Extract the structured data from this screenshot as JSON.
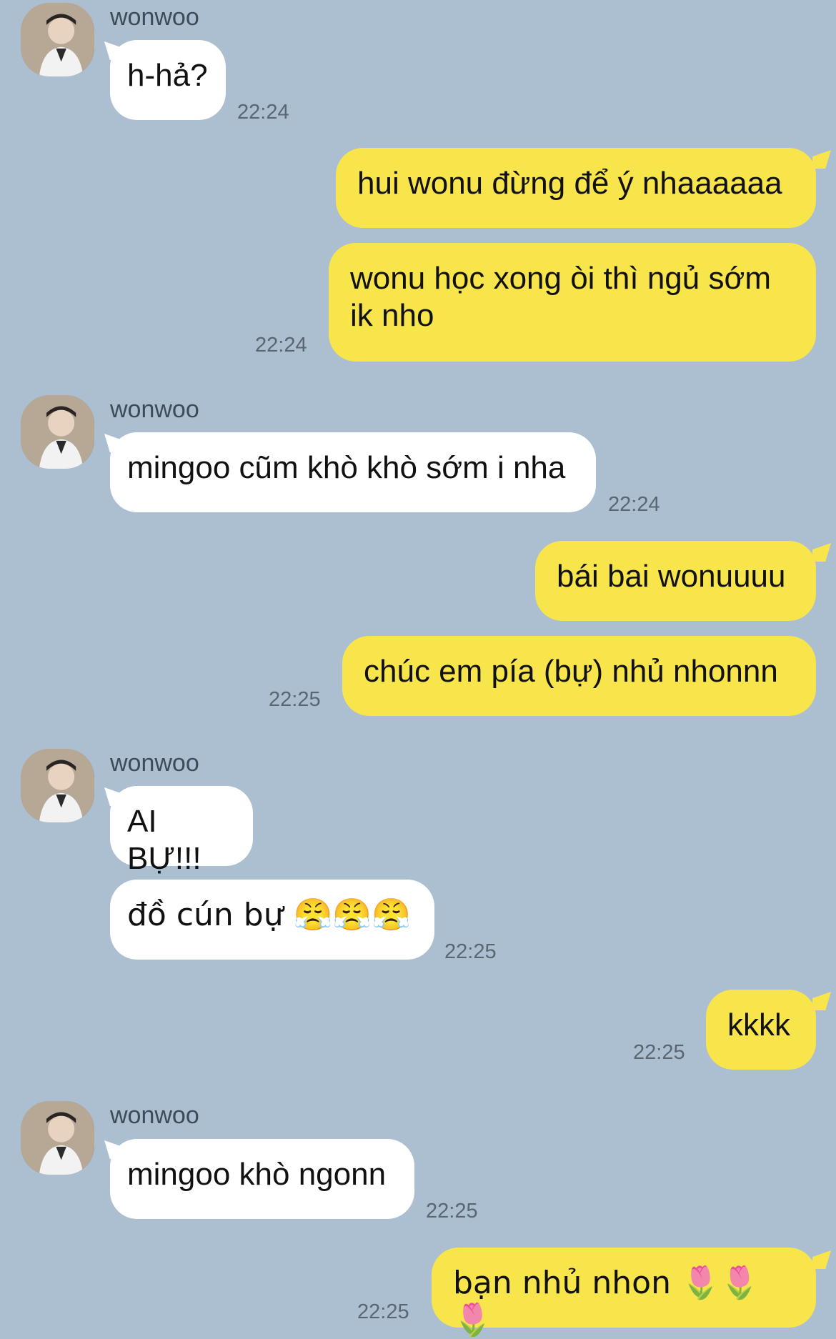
{
  "contact_name": "wonwoo",
  "messages": {
    "m1": {
      "text": "h-hả?",
      "time": "22:24"
    },
    "m2": {
      "text": "hui wonu đừng để ý nhaaaaaa"
    },
    "m3": {
      "text": "wonu học xong òi thì ngủ sớm\nik nho",
      "time": "22:24"
    },
    "m4": {
      "text": "mingoo cũm khò khò sớm i nha",
      "time": "22:24"
    },
    "m5": {
      "text": "bái bai wonuuuu"
    },
    "m6": {
      "text": "chúc em pía (bự) nhủ nhonnn",
      "time": "22:25"
    },
    "m7": {
      "text": "AI BỰ!!!"
    },
    "m8": {
      "text": "đồ cún bự 😤😤😤",
      "time": "22:25"
    },
    "m9": {
      "text": "kkkk",
      "time": "22:25"
    },
    "m10": {
      "text": "mingoo khò ngonn",
      "time": "22:25"
    },
    "m11": {
      "text": "bạn nhủ nhon 🌷🌷🌷",
      "time": "22:25"
    }
  },
  "colors": {
    "background": "#acbfd1",
    "incoming_bubble": "#ffffff",
    "outgoing_bubble": "#f8e54c"
  }
}
